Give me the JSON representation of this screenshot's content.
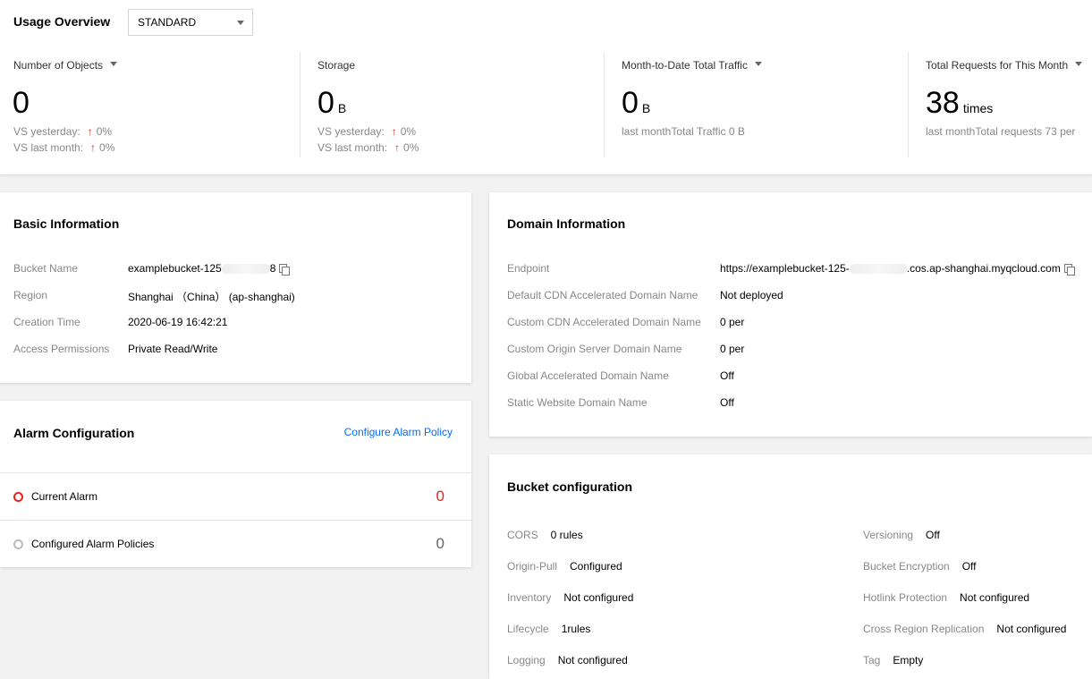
{
  "usage": {
    "title": "Usage Overview",
    "storage_class": "STANDARD",
    "metrics": [
      {
        "label": "Number of Objects",
        "value": "0",
        "unit": "",
        "lines": [
          {
            "text": "VS yesterday:",
            "change": "0%"
          },
          {
            "text": "VS last month:",
            "change": "0%"
          }
        ]
      },
      {
        "label": "Storage",
        "value": "0",
        "unit": "B",
        "lines": [
          {
            "text": "VS yesterday:",
            "change": "0%"
          },
          {
            "text": "VS last month:",
            "change": "0%"
          }
        ]
      },
      {
        "label": "Month-to-Date Total Traffic",
        "value": "0",
        "unit": "B",
        "note": "last monthTotal Traffic 0 B"
      },
      {
        "label": "Total Requests for This Month",
        "value": "38",
        "unit": "times",
        "note": "last monthTotal requests 73 per"
      }
    ],
    "arrow": "↑"
  },
  "basic": {
    "title": "Basic Information",
    "rows": [
      {
        "k": "Bucket Name",
        "v1": "examplebucket-125",
        "v2": "8"
      },
      {
        "k": "Region",
        "v": "Shanghai （China） (ap-shanghai)"
      },
      {
        "k": "Creation Time",
        "v": "2020-06-19 16:42:21"
      },
      {
        "k": "Access Permissions",
        "v": "Private Read/Write"
      }
    ]
  },
  "alarm": {
    "title": "Alarm Configuration",
    "link": "Configure Alarm Policy",
    "current_label": "Current Alarm",
    "current_count": "0",
    "configured_label": "Configured Alarm Policies",
    "configured_count": "0",
    "alert_color": "#e1251b"
  },
  "domain": {
    "title": "Domain Information",
    "rows": [
      {
        "k": "Endpoint",
        "v1": "https://examplebucket-125-",
        "v2": ".cos.ap-shanghai.myqcloud.com"
      },
      {
        "k": "Default CDN Accelerated Domain Name",
        "v": "Not deployed"
      },
      {
        "k": "Custom CDN Accelerated Domain Name",
        "v": "0 per"
      },
      {
        "k": "Custom Origin Server Domain Name",
        "v": "0 per"
      },
      {
        "k": "Global Accelerated Domain Name",
        "v": "Off"
      },
      {
        "k": "Static Website Domain Name",
        "v": "Off"
      }
    ]
  },
  "bucket_config": {
    "title": "Bucket configuration",
    "left": [
      {
        "k": "CORS",
        "v": "0 rules"
      },
      {
        "k": "Origin-Pull",
        "v": "Configured"
      },
      {
        "k": "Inventory",
        "v": "Not configured"
      },
      {
        "k": "Lifecycle",
        "v": "1rules"
      },
      {
        "k": "Logging",
        "v": "Not configured"
      }
    ],
    "right": [
      {
        "k": "Versioning",
        "v": "Off"
      },
      {
        "k": "Bucket Encryption",
        "v": "Off"
      },
      {
        "k": "Hotlink Protection",
        "v": "Not configured"
      },
      {
        "k": "Cross Region Replication",
        "v": "Not configured"
      },
      {
        "k": "Tag",
        "v": "Empty"
      }
    ]
  }
}
